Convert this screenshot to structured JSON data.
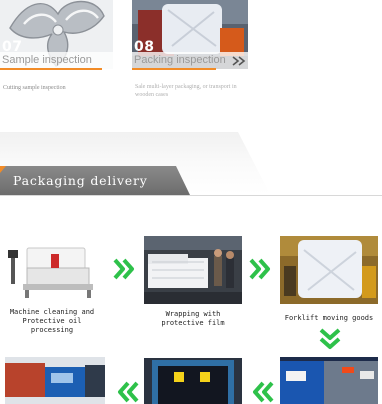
{
  "inspection_cards": [
    {
      "number": "07",
      "title": "Sample inspection",
      "description": "Cutting sample inspection"
    },
    {
      "number": "08",
      "title": "Packing inspection",
      "description": "Sale multi-layer packaging, or transport in wooden cases"
    }
  ],
  "section": {
    "title": "Packaging delivery"
  },
  "steps": [
    {
      "caption": "Machine cleaning and\nProtective oil processing"
    },
    {
      "caption": "Wrapping with\nprotective film"
    },
    {
      "caption": "Forklift moving goods"
    }
  ],
  "colors": {
    "accent_green": "#2ec14a",
    "accent_orange": "#f28c28",
    "banner_gray": "#7a7a7a"
  },
  "icons": [
    "chevron-double-right-icon",
    "chevron-double-down-icon",
    "chevron-double-left-icon"
  ]
}
